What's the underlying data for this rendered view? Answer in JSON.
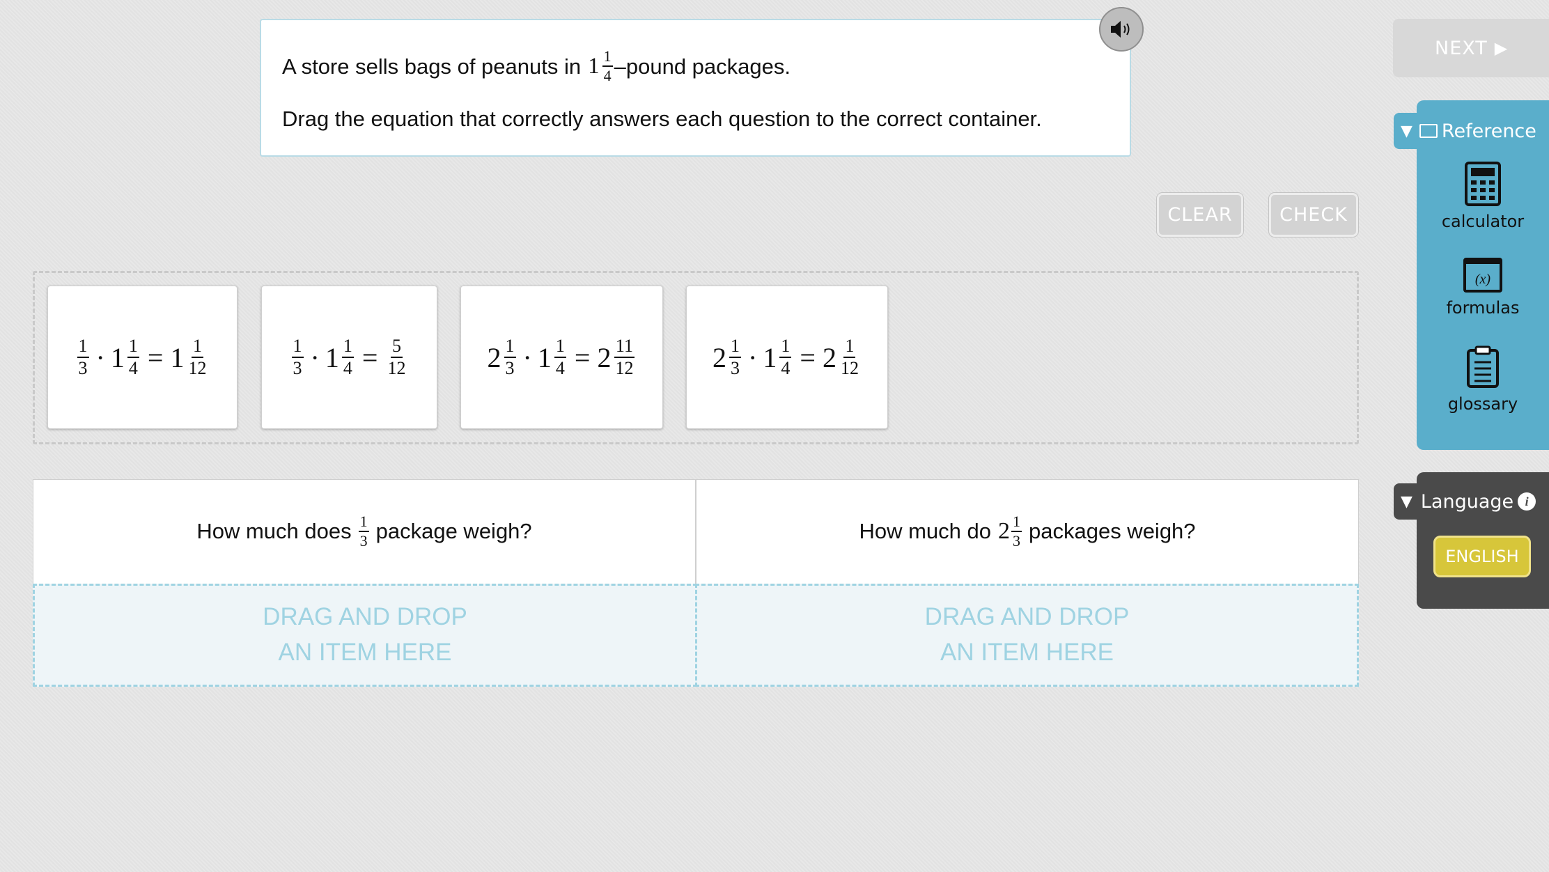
{
  "prompt": {
    "line1_before": "A store sells bags of peanuts in",
    "line1_whole": "1",
    "line1_num": "1",
    "line1_den": "4",
    "line1_after": "–pound packages.",
    "line2": "Drag the equation that correctly answers each question to the correct container."
  },
  "toolbar": {
    "clear_label": "CLEAR",
    "check_label": "CHECK",
    "next_label": "NEXT",
    "next_arrow": "▶"
  },
  "cards": [
    {
      "a_whole": "",
      "a_num": "1",
      "a_den": "3",
      "b_whole": "1",
      "b_num": "1",
      "b_den": "4",
      "c_whole": "1",
      "c_num": "1",
      "c_den": "12"
    },
    {
      "a_whole": "",
      "a_num": "1",
      "a_den": "3",
      "b_whole": "1",
      "b_num": "1",
      "b_den": "4",
      "c_whole": "",
      "c_num": "5",
      "c_den": "12"
    },
    {
      "a_whole": "2",
      "a_num": "1",
      "a_den": "3",
      "b_whole": "1",
      "b_num": "1",
      "b_den": "4",
      "c_whole": "2",
      "c_num": "11",
      "c_den": "12"
    },
    {
      "a_whole": "2",
      "a_num": "1",
      "a_den": "3",
      "b_whole": "1",
      "b_num": "1",
      "b_den": "4",
      "c_whole": "2",
      "c_num": "1",
      "c_den": "12"
    }
  ],
  "symbols": {
    "dot": "·",
    "eq": "="
  },
  "questions": [
    {
      "before": "How much does",
      "whole": "",
      "num": "1",
      "den": "3",
      "after": "package weigh?"
    },
    {
      "before": "How much do",
      "whole": "2",
      "num": "1",
      "den": "3",
      "after": "packages weigh?"
    }
  ],
  "drop_zone": {
    "line1": "DRAG AND DROP",
    "line2": "AN ITEM HERE"
  },
  "reference": {
    "title": "Reference",
    "tools": [
      {
        "label": "calculator",
        "icon": "calculator-icon"
      },
      {
        "label": "formulas",
        "icon": "formulas-icon",
        "icon_text": "(x)"
      },
      {
        "label": "glossary",
        "icon": "clipboard-icon"
      }
    ]
  },
  "language": {
    "title": "Language",
    "info_glyph": "i",
    "current": "ENGLISH"
  },
  "colors": {
    "accent_blue": "#5aaecb",
    "drop_blue": "#9fd3e2",
    "english_yellow": "#d7c63a",
    "dark_panel": "#4a4a4a"
  }
}
